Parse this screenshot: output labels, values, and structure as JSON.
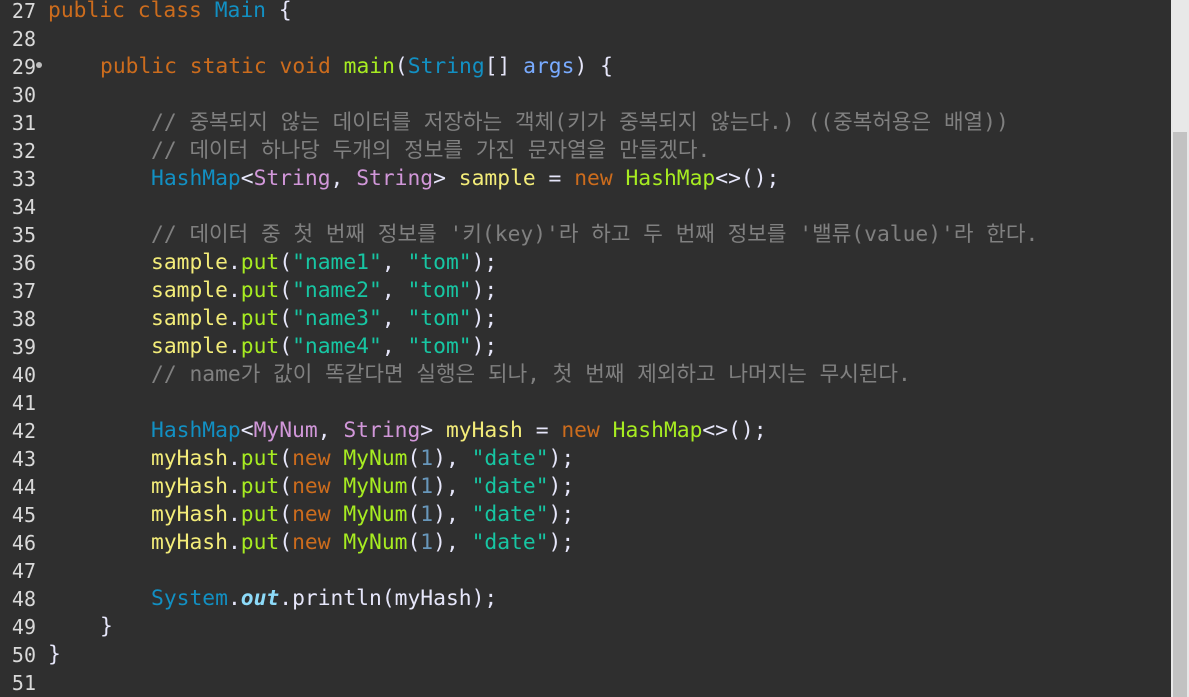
{
  "editor": {
    "colors": {
      "background": "#2f2f2f",
      "keyword": "#cc6c1d",
      "class": "#1290c3",
      "type": "#d197d9",
      "method": "#a7ec21",
      "string": "#17c6a3",
      "number": "#6897bb",
      "variable": "#f3ec79",
      "parameter": "#79abff",
      "comment": "#808080",
      "static_field": "#8ddaf8"
    },
    "line_numbers": [
      "27",
      "28",
      "29",
      "30",
      "31",
      "32",
      "33",
      "34",
      "35",
      "36",
      "37",
      "38",
      "39",
      "40",
      "41",
      "42",
      "43",
      "44",
      "45",
      "46",
      "47",
      "48",
      "49",
      "50",
      "51"
    ],
    "code": {
      "l27": {
        "kw": "public class",
        "cls": "Main",
        "brace": " {"
      },
      "l29": {
        "kw1": "public static void",
        "fn": "main",
        "p1": "(",
        "cls": "String",
        "p2": "[] ",
        "prm": "args",
        "p3": ") {"
      },
      "l31": {
        "cmt": "// 중복되지 않는 데이터를 저장하는 객체(키가 중복되지 않는다.) ((중복허용은 배열))"
      },
      "l32": {
        "cmt": "// 데이터 하나당 두개의 정보를 가진 문자열을 만들겠다."
      },
      "l33": {
        "cls1": "HashMap",
        "lt": "<",
        "typ1": "String",
        "comma": ", ",
        "typ2": "String",
        "gt": "> ",
        "var": "sample",
        "eq": " = ",
        "kw": "new",
        "cls2": "HashMap",
        "end": "<>();"
      },
      "l35": {
        "cmt": "// 데이터 중 첫 번째 정보를 '키(key)'라 하고 두 번째 정보를 '밸류(value)'라 한다."
      },
      "l36": {
        "var": "sample",
        "dot": ".",
        "fn": "put",
        "op": "(",
        "s1": "\"name1\"",
        "comma": ", ",
        "s2": "\"tom\"",
        "end": ");"
      },
      "l37": {
        "var": "sample",
        "dot": ".",
        "fn": "put",
        "op": "(",
        "s1": "\"name2\"",
        "comma": ", ",
        "s2": "\"tom\"",
        "end": ");"
      },
      "l38": {
        "var": "sample",
        "dot": ".",
        "fn": "put",
        "op": "(",
        "s1": "\"name3\"",
        "comma": ", ",
        "s2": "\"tom\"",
        "end": ");"
      },
      "l39": {
        "var": "sample",
        "dot": ".",
        "fn": "put",
        "op": "(",
        "s1": "\"name4\"",
        "comma": ", ",
        "s2": "\"tom\"",
        "end": ");"
      },
      "l40": {
        "cmt": "// name가 값이 똑같다면 실행은 되나, 첫 번째 제외하고 나머지는 무시된다."
      },
      "l42": {
        "cls1": "HashMap",
        "lt": "<",
        "typ1": "MyNum",
        "comma": ", ",
        "typ2": "String",
        "gt": "> ",
        "var": "myHash",
        "eq": " = ",
        "kw": "new",
        "cls2": "HashMap",
        "end": "<>();"
      },
      "l43": {
        "var": "myHash",
        "dot": ".",
        "fn": "put",
        "op": "(",
        "kw": "new",
        "sp": " ",
        "cls": "MyNum",
        "o2": "(",
        "num": "1",
        "c2": "), ",
        "str": "\"date\"",
        "end": ");"
      },
      "l44": {
        "var": "myHash",
        "dot": ".",
        "fn": "put",
        "op": "(",
        "kw": "new",
        "sp": " ",
        "cls": "MyNum",
        "o2": "(",
        "num": "1",
        "c2": "), ",
        "str": "\"date\"",
        "end": ");"
      },
      "l45": {
        "var": "myHash",
        "dot": ".",
        "fn": "put",
        "op": "(",
        "kw": "new",
        "sp": " ",
        "cls": "MyNum",
        "o2": "(",
        "num": "1",
        "c2": "), ",
        "str": "\"date\"",
        "end": ");"
      },
      "l46": {
        "var": "myHash",
        "dot": ".",
        "fn": "put",
        "op": "(",
        "kw": "new",
        "sp": " ",
        "cls": "MyNum",
        "o2": "(",
        "num": "1",
        "c2": "), ",
        "str": "\"date\"",
        "end": ");"
      },
      "l48": {
        "cls": "System",
        "dot1": ".",
        "fld": "out",
        "dot2": ".",
        "fn": "println",
        "op": "(",
        "var": "myHash",
        "end": ");"
      },
      "l49": {
        "brace": "}"
      },
      "l50": {
        "brace": "}"
      }
    }
  }
}
